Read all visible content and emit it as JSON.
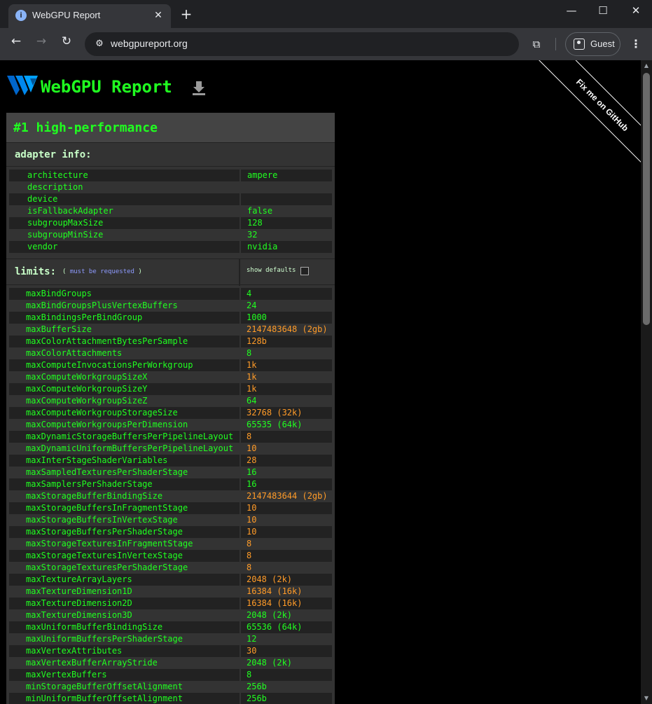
{
  "browser": {
    "tab_title": "WebGPU Report",
    "url": "webgpureport.org",
    "profile_label": "Guest"
  },
  "page": {
    "site_title": "WebGPU Report",
    "ribbon_text": "Fix me on GitHub",
    "adapter_heading": "#1 high-performance",
    "adapter_info_label": "adapter info:",
    "limits_label": "limits:",
    "limits_note_open": "(",
    "limits_note_link": "must be requested",
    "limits_note_close": ")",
    "show_defaults_label": "show defaults",
    "show_defaults_checked": false,
    "colors": {
      "accent_green": "#20ff20",
      "warn_orange": "#ff9b28",
      "link_blue": "#8e9bff"
    }
  },
  "adapter_info": [
    {
      "key": "architecture",
      "value": "ampere"
    },
    {
      "key": "description",
      "value": ""
    },
    {
      "key": "device",
      "value": ""
    },
    {
      "key": "isFallbackAdapter",
      "value": "false"
    },
    {
      "key": "subgroupMaxSize",
      "value": "128"
    },
    {
      "key": "subgroupMinSize",
      "value": "32"
    },
    {
      "key": "vendor",
      "value": "nvidia"
    }
  ],
  "limits": [
    {
      "key": "maxBindGroups",
      "value": "4",
      "highlight": false
    },
    {
      "key": "maxBindGroupsPlusVertexBuffers",
      "value": "24",
      "highlight": false
    },
    {
      "key": "maxBindingsPerBindGroup",
      "value": "1000",
      "highlight": false
    },
    {
      "key": "maxBufferSize",
      "value": "2147483648 (2gb)",
      "highlight": true
    },
    {
      "key": "maxColorAttachmentBytesPerSample",
      "value": "128b",
      "highlight": true
    },
    {
      "key": "maxColorAttachments",
      "value": "8",
      "highlight": false
    },
    {
      "key": "maxComputeInvocationsPerWorkgroup",
      "value": "1k",
      "highlight": true
    },
    {
      "key": "maxComputeWorkgroupSizeX",
      "value": "1k",
      "highlight": true
    },
    {
      "key": "maxComputeWorkgroupSizeY",
      "value": "1k",
      "highlight": true
    },
    {
      "key": "maxComputeWorkgroupSizeZ",
      "value": "64",
      "highlight": false
    },
    {
      "key": "maxComputeWorkgroupStorageSize",
      "value": "32768 (32k)",
      "highlight": true
    },
    {
      "key": "maxComputeWorkgroupsPerDimension",
      "value": "65535 (64k)",
      "highlight": false
    },
    {
      "key": "maxDynamicStorageBuffersPerPipelineLayout",
      "value": "8",
      "highlight": true
    },
    {
      "key": "maxDynamicUniformBuffersPerPipelineLayout",
      "value": "10",
      "highlight": true
    },
    {
      "key": "maxInterStageShaderVariables",
      "value": "28",
      "highlight": true
    },
    {
      "key": "maxSampledTexturesPerShaderStage",
      "value": "16",
      "highlight": false
    },
    {
      "key": "maxSamplersPerShaderStage",
      "value": "16",
      "highlight": false
    },
    {
      "key": "maxStorageBufferBindingSize",
      "value": "2147483644 (2gb)",
      "highlight": true
    },
    {
      "key": "maxStorageBuffersInFragmentStage",
      "value": "10",
      "highlight": true
    },
    {
      "key": "maxStorageBuffersInVertexStage",
      "value": "10",
      "highlight": true
    },
    {
      "key": "maxStorageBuffersPerShaderStage",
      "value": "10",
      "highlight": true
    },
    {
      "key": "maxStorageTexturesInFragmentStage",
      "value": "8",
      "highlight": true
    },
    {
      "key": "maxStorageTexturesInVertexStage",
      "value": "8",
      "highlight": true
    },
    {
      "key": "maxStorageTexturesPerShaderStage",
      "value": "8",
      "highlight": true
    },
    {
      "key": "maxTextureArrayLayers",
      "value": "2048 (2k)",
      "highlight": true
    },
    {
      "key": "maxTextureDimension1D",
      "value": "16384 (16k)",
      "highlight": true
    },
    {
      "key": "maxTextureDimension2D",
      "value": "16384 (16k)",
      "highlight": true
    },
    {
      "key": "maxTextureDimension3D",
      "value": "2048 (2k)",
      "highlight": false
    },
    {
      "key": "maxUniformBufferBindingSize",
      "value": "65536 (64k)",
      "highlight": false
    },
    {
      "key": "maxUniformBuffersPerShaderStage",
      "value": "12",
      "highlight": false
    },
    {
      "key": "maxVertexAttributes",
      "value": "30",
      "highlight": true
    },
    {
      "key": "maxVertexBufferArrayStride",
      "value": "2048 (2k)",
      "highlight": false
    },
    {
      "key": "maxVertexBuffers",
      "value": "8",
      "highlight": false
    },
    {
      "key": "minStorageBufferOffsetAlignment",
      "value": "256b",
      "highlight": false
    },
    {
      "key": "minUniformBufferOffsetAlignment",
      "value": "256b",
      "highlight": false
    }
  ]
}
